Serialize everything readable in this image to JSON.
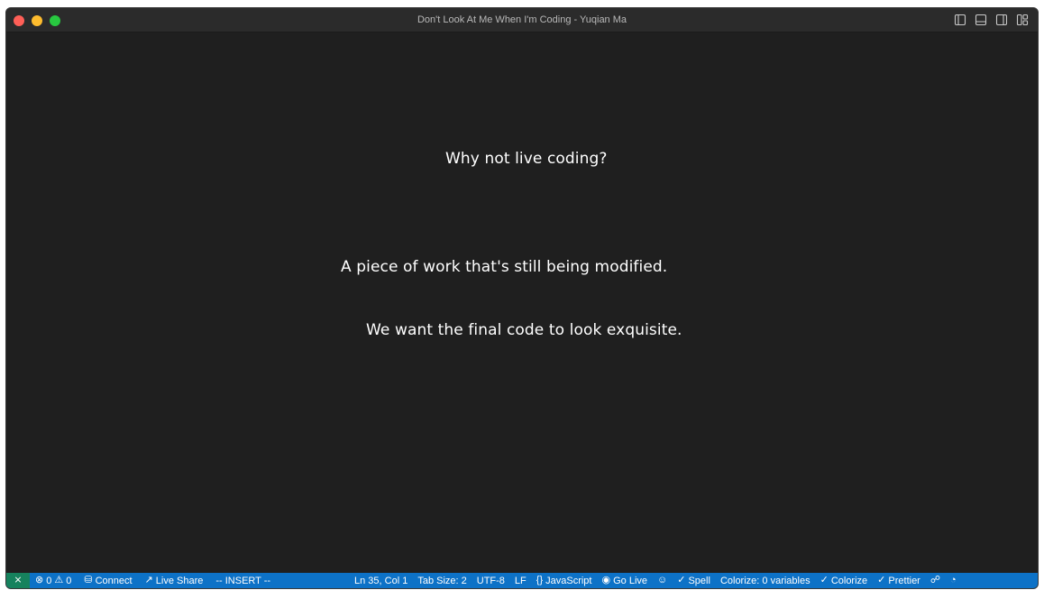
{
  "window": {
    "title": "Don't Look At Me When I'm Coding - Yuqian Ma",
    "layout_icons": [
      "sidebar-left-icon",
      "panel-bottom-icon",
      "sidebar-right-icon",
      "customize-layout-icon"
    ]
  },
  "editor": {
    "lines": [
      "Why not live coding?",
      "A piece of work that's still being modified.",
      "We want the final code to look exquisite."
    ]
  },
  "statusbar": {
    "remote_icon": "remote-icon",
    "errors": "0",
    "warnings": "0",
    "connect": "Connect",
    "live_share": "Live Share",
    "mode": "-- INSERT --",
    "position": "Ln 35, Col 1",
    "tab_size": "Tab Size: 2",
    "encoding": "UTF-8",
    "eol": "LF",
    "language": "JavaScript",
    "go_live": "Go Live",
    "spell": "Spell",
    "colorize_vars": "Colorize: 0 variables",
    "colorize": "Colorize",
    "prettier": "Prettier",
    "colors": {
      "bar": "#0d72c7",
      "remote": "#16825d"
    }
  }
}
